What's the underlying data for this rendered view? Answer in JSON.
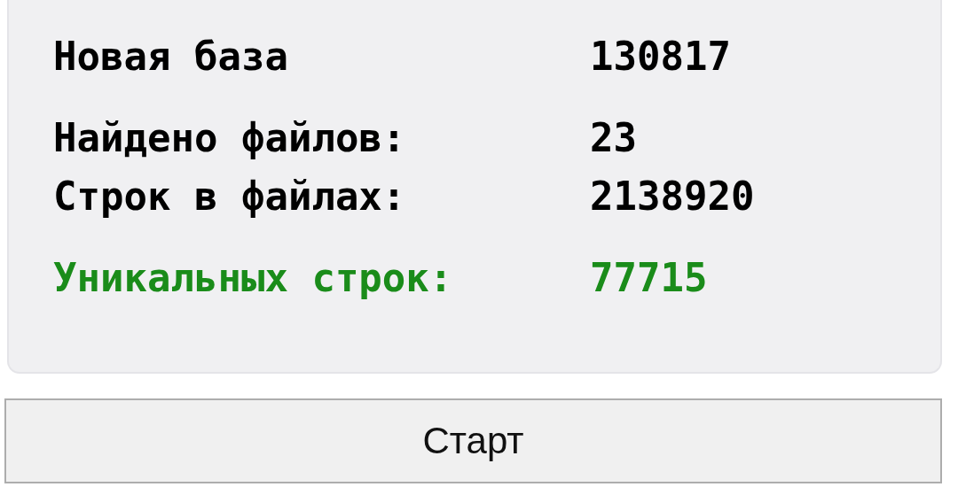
{
  "stats_panel": {
    "groups": [
      {
        "rows": [
          {
            "label": "Новая база",
            "value": "130817",
            "color": "#000000"
          }
        ]
      },
      {
        "rows": [
          {
            "label": "Найдено файлов:",
            "value": "23",
            "color": "#000000"
          },
          {
            "label": "Строк в файлах:",
            "value": "2138920",
            "color": "#000000"
          }
        ]
      },
      {
        "rows": [
          {
            "label": "Уникальных строк:",
            "value": "77715",
            "color": "#1a8c1a"
          }
        ]
      }
    ]
  },
  "start_button": {
    "label": "Старт"
  }
}
